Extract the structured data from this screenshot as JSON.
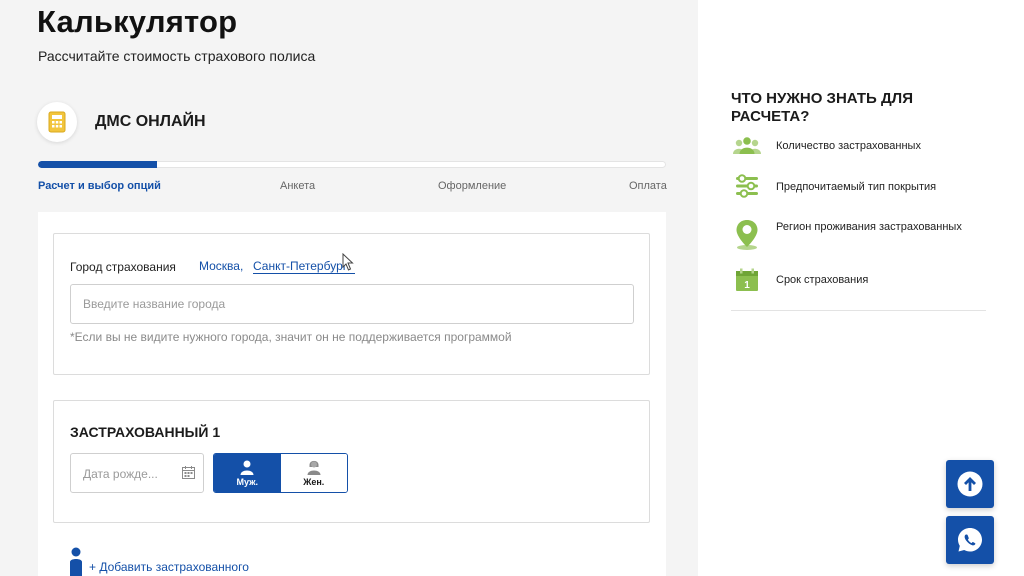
{
  "header": {
    "title": "Калькулятор",
    "subtitle": "Рассчитайте стоимость страхового полиса"
  },
  "product": {
    "icon": "calculator-icon",
    "title": "ДМС ОНЛАЙН"
  },
  "progress": {
    "fraction": 0.19,
    "steps": [
      {
        "label": "Расчет и выбор опций",
        "active": true
      },
      {
        "label": "Анкета",
        "active": false
      },
      {
        "label": "Оформление",
        "active": false
      },
      {
        "label": "Оплата",
        "active": false
      }
    ]
  },
  "city": {
    "label": "Город страхования",
    "quick_links": [
      "Москва,",
      "Санкт-Петербург"
    ],
    "input_placeholder": "Введите название города",
    "note": "*Если вы не видите нужного города, значит он не поддерживается программой"
  },
  "insured": {
    "title": "ЗАСТРАХОВАННЫЙ 1",
    "birth_placeholder": "Дата рожде...",
    "gender_male": "Муж.",
    "gender_female": "Жен.",
    "selected_gender": "Муж."
  },
  "add_insured": {
    "label": "+ Добавить застрахованного"
  },
  "aside": {
    "title": "ЧТО НУЖНО ЗНАТЬ ДЛЯ РАСЧЕТА?",
    "tips": [
      {
        "icon": "people-icon",
        "text": "Количество застрахованных"
      },
      {
        "icon": "sliders-icon",
        "text": "Предпочитаемый тип покрытия"
      },
      {
        "icon": "location-pin-icon",
        "text": "Регион проживания застрахованных"
      },
      {
        "icon": "calendar-icon",
        "text": "Срок страхования",
        "day": "1"
      }
    ]
  },
  "fabs": {
    "scroll_top_icon": "arrow-up-icon",
    "chat_icon": "whatsapp-icon"
  },
  "colors": {
    "accent": "#1450a8",
    "tip_green": "#8cbf4f",
    "product_icon": "#f2c53d"
  }
}
